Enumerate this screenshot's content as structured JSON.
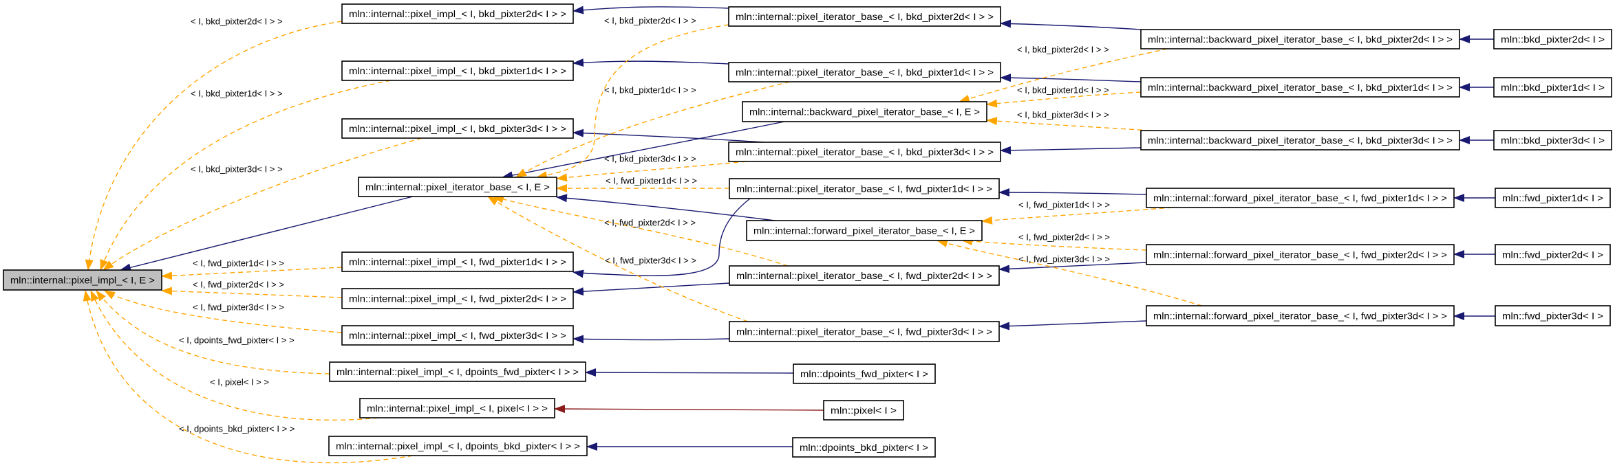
{
  "colors": {
    "inheritance": "#191970",
    "private_inheritance": "#8b1a1a",
    "template_instance": "#ffa500",
    "current_node": "#bfbfbf"
  },
  "nodes": {
    "pixel_impl_IE": "mln::internal::pixel_impl_< I, E >",
    "pi_bkd2d": "mln::internal::pixel_impl_< I, bkd_pixter2d< I > >",
    "pi_bkd1d": "mln::internal::pixel_impl_< I, bkd_pixter1d< I > >",
    "pi_bkd3d": "mln::internal::pixel_impl_< I, bkd_pixter3d< I > >",
    "pib_IE": "mln::internal::pixel_iterator_base_< I, E >",
    "pi_fwd1d": "mln::internal::pixel_impl_< I, fwd_pixter1d< I > >",
    "pi_fwd2d": "mln::internal::pixel_impl_< I, fwd_pixter2d< I > >",
    "pi_fwd3d": "mln::internal::pixel_impl_< I, fwd_pixter3d< I > >",
    "pi_dpoints_fwd": "mln::internal::pixel_impl_< I, dpoints_fwd_pixter< I > >",
    "pi_pixel": "mln::internal::pixel_impl_< I, pixel< I > >",
    "pi_dpoints_bkd": "mln::internal::pixel_impl_< I, dpoints_bkd_pixter< I > >",
    "pib_bkd2d": "mln::internal::pixel_iterator_base_< I, bkd_pixter2d< I > >",
    "pib_bkd1d": "mln::internal::pixel_iterator_base_< I, bkd_pixter1d< I > >",
    "bwd_IE": "mln::internal::backward_pixel_iterator_base_< I, E >",
    "pib_bkd3d": "mln::internal::pixel_iterator_base_< I, bkd_pixter3d< I > >",
    "pib_fwd1d": "mln::internal::pixel_iterator_base_< I, fwd_pixter1d< I > >",
    "fwd_IE": "mln::internal::forward_pixel_iterator_base_< I, E >",
    "pib_fwd2d": "mln::internal::pixel_iterator_base_< I, fwd_pixter2d< I > >",
    "pib_fwd3d": "mln::internal::pixel_iterator_base_< I, fwd_pixter3d< I > >",
    "dpoints_fwd_pixter": "mln::dpoints_fwd_pixter< I >",
    "pixel": "mln::pixel< I >",
    "dpoints_bkd_pixter": "mln::dpoints_bkd_pixter< I >",
    "bwd_bkd2d": "mln::internal::backward_pixel_iterator_base_< I, bkd_pixter2d< I > >",
    "bwd_bkd1d": "mln::internal::backward_pixel_iterator_base_< I, bkd_pixter1d< I > >",
    "bwd_bkd3d": "mln::internal::backward_pixel_iterator_base_< I, bkd_pixter3d< I > >",
    "fwd_fwd1d": "mln::internal::forward_pixel_iterator_base_< I, fwd_pixter1d< I > >",
    "fwd_fwd2d": "mln::internal::forward_pixel_iterator_base_< I, fwd_pixter2d< I > >",
    "fwd_fwd3d": "mln::internal::forward_pixel_iterator_base_< I, fwd_pixter3d< I > >",
    "bkd_pixter2d": "mln::bkd_pixter2d< I >",
    "bkd_pixter1d": "mln::bkd_pixter1d< I >",
    "bkd_pixter3d": "mln::bkd_pixter3d< I >",
    "fwd_pixter1d": "mln::fwd_pixter1d< I >",
    "fwd_pixter2d": "mln::fwd_pixter2d< I >",
    "fwd_pixter3d": "mln::fwd_pixter3d< I >"
  },
  "edge_labels": {
    "left": [
      "< I, bkd_pixter2d< I > >",
      "< I, bkd_pixter1d< I > >",
      "< I, bkd_pixter3d< I > >",
      "< I, fwd_pixter1d< I > >",
      "< I, fwd_pixter2d< I > >",
      "< I, fwd_pixter3d< I > >",
      "< I, dpoints_fwd_pixter< I > >",
      "< I, pixel< I > >",
      "< I, dpoints_bkd_pixter< I > >"
    ],
    "middle": [
      "< I, bkd_pixter2d< I > >",
      "< I, bkd_pixter1d< I > >",
      "< I, bkd_pixter3d< I > >",
      "< I, fwd_pixter1d< I > >",
      "< I, fwd_pixter2d< I > >",
      "< I, fwd_pixter3d< I > >"
    ],
    "right": [
      "< I, bkd_pixter2d< I > >",
      "< I, bkd_pixter1d< I > >",
      "< I, bkd_pixter3d< I > >",
      "< I, fwd_pixter1d< I > >",
      "< I, fwd_pixter2d< I > >",
      "< I, fwd_pixter3d< I > >"
    ]
  }
}
